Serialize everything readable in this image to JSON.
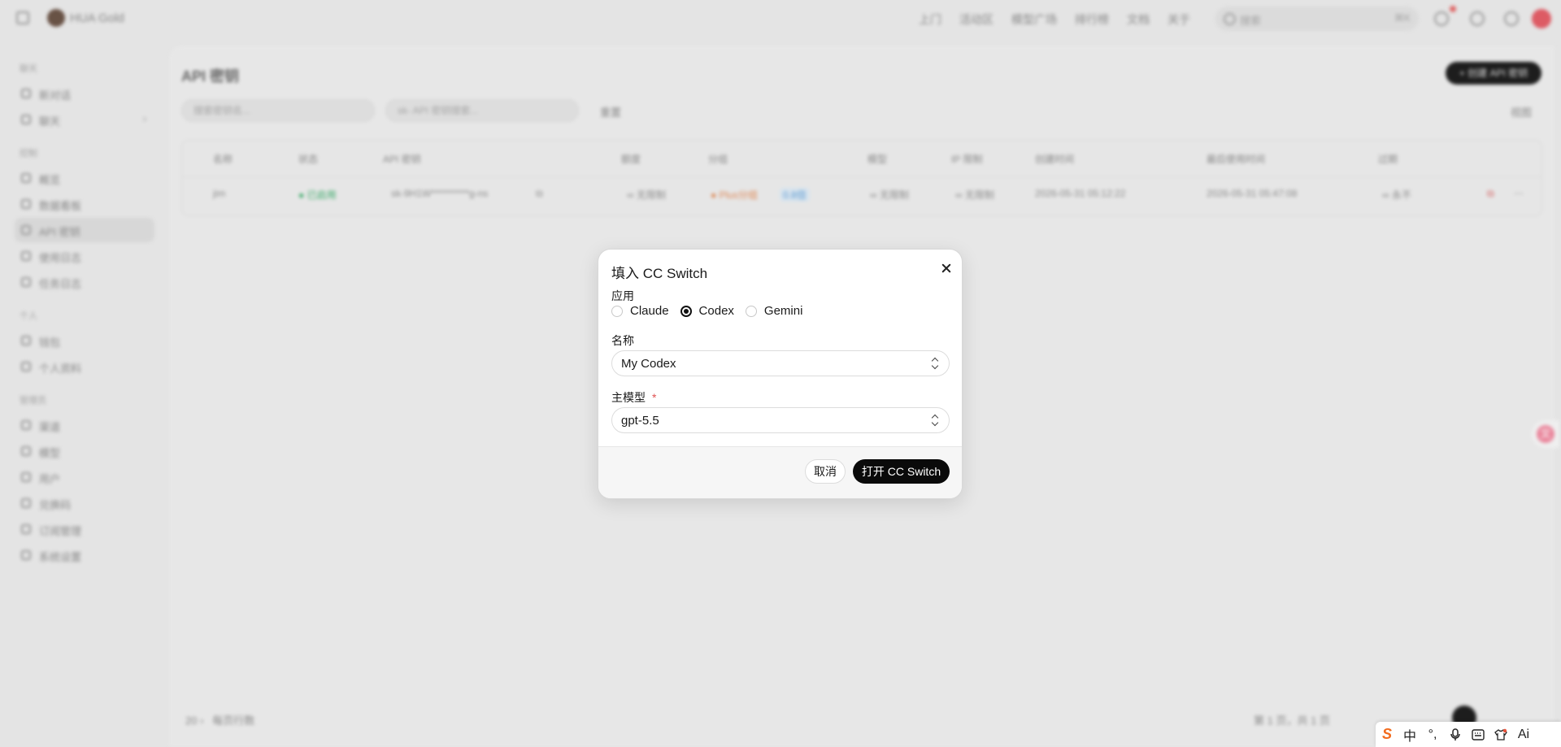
{
  "background": {
    "brand": "HUA Gold",
    "topnav": [
      "上门",
      "活动区",
      "模型广场",
      "排行榜",
      "文档",
      "关于"
    ],
    "search_placeholder": "搜索",
    "search_shortcut": "⌘K",
    "sidebar": {
      "sections": [
        {
          "title": "聊天",
          "items": [
            {
              "label": "新对话"
            },
            {
              "label": "聊天",
              "has_chevron": true
            }
          ]
        },
        {
          "title": "控制",
          "items": [
            {
              "label": "概览"
            },
            {
              "label": "数据看板"
            },
            {
              "label": "API 密钥",
              "active": true
            },
            {
              "label": "使用日志"
            },
            {
              "label": "任务日志"
            }
          ]
        },
        {
          "title": "个人",
          "items": [
            {
              "label": "钱包"
            },
            {
              "label": "个人资料"
            }
          ]
        },
        {
          "title": "管理员",
          "items": [
            {
              "label": "渠道"
            },
            {
              "label": "模型"
            },
            {
              "label": "用户"
            },
            {
              "label": "兑换码"
            },
            {
              "label": "订阅管理"
            },
            {
              "label": "系统设置"
            }
          ]
        }
      ]
    },
    "page_title": "API 密钥",
    "create_button": "+ 创建 API 密钥",
    "filter_name_placeholder": "搜索密钥名...",
    "filter_key_placeholder": "sk- API 密钥搜索...",
    "reset_label": "重置",
    "columns_label": "视图",
    "table": {
      "headers": [
        "名称",
        "状态",
        "API 密钥",
        "额度",
        "分组",
        "模型",
        "IP 限制",
        "创建时间",
        "最后使用时间",
        "过期"
      ],
      "row": {
        "name": "jim",
        "status": "● 已启用",
        "key": "sk-9H1W**********g-ns",
        "quota": "∞ 无限制",
        "group_tag": "● Plus分组",
        "group_badge": "0.8倍",
        "models": "∞ 无限制",
        "ip_limit": "∞ 无限制",
        "created": "2026-05-31 05:12:22",
        "last_used": "2026-05-31 05:47:08",
        "expires": "∞ 永不"
      }
    },
    "pager_size": "20",
    "pager_label": "每页行数",
    "pager_info": "第 1 页，共 1 页"
  },
  "dialog": {
    "title": "填入 CC Switch",
    "app_label": "应用",
    "apps": [
      {
        "label": "Claude",
        "checked": false
      },
      {
        "label": "Codex",
        "checked": true
      },
      {
        "label": "Gemini",
        "checked": false
      }
    ],
    "name_label": "名称",
    "name_value": "My Codex",
    "model_label": "主模型",
    "model_required": "*",
    "model_value": "gpt-5.5",
    "cancel_label": "取消",
    "confirm_label": "打开 CC Switch"
  },
  "ime_toolbar": [
    "S",
    "中",
    "°,",
    "mic",
    "kbd",
    "shirt",
    "Ai"
  ],
  "colors": {
    "primary": "#0a0a0a",
    "required": "#e05252",
    "status_green": "#3cae6b",
    "group_orange": "#e38a55"
  }
}
